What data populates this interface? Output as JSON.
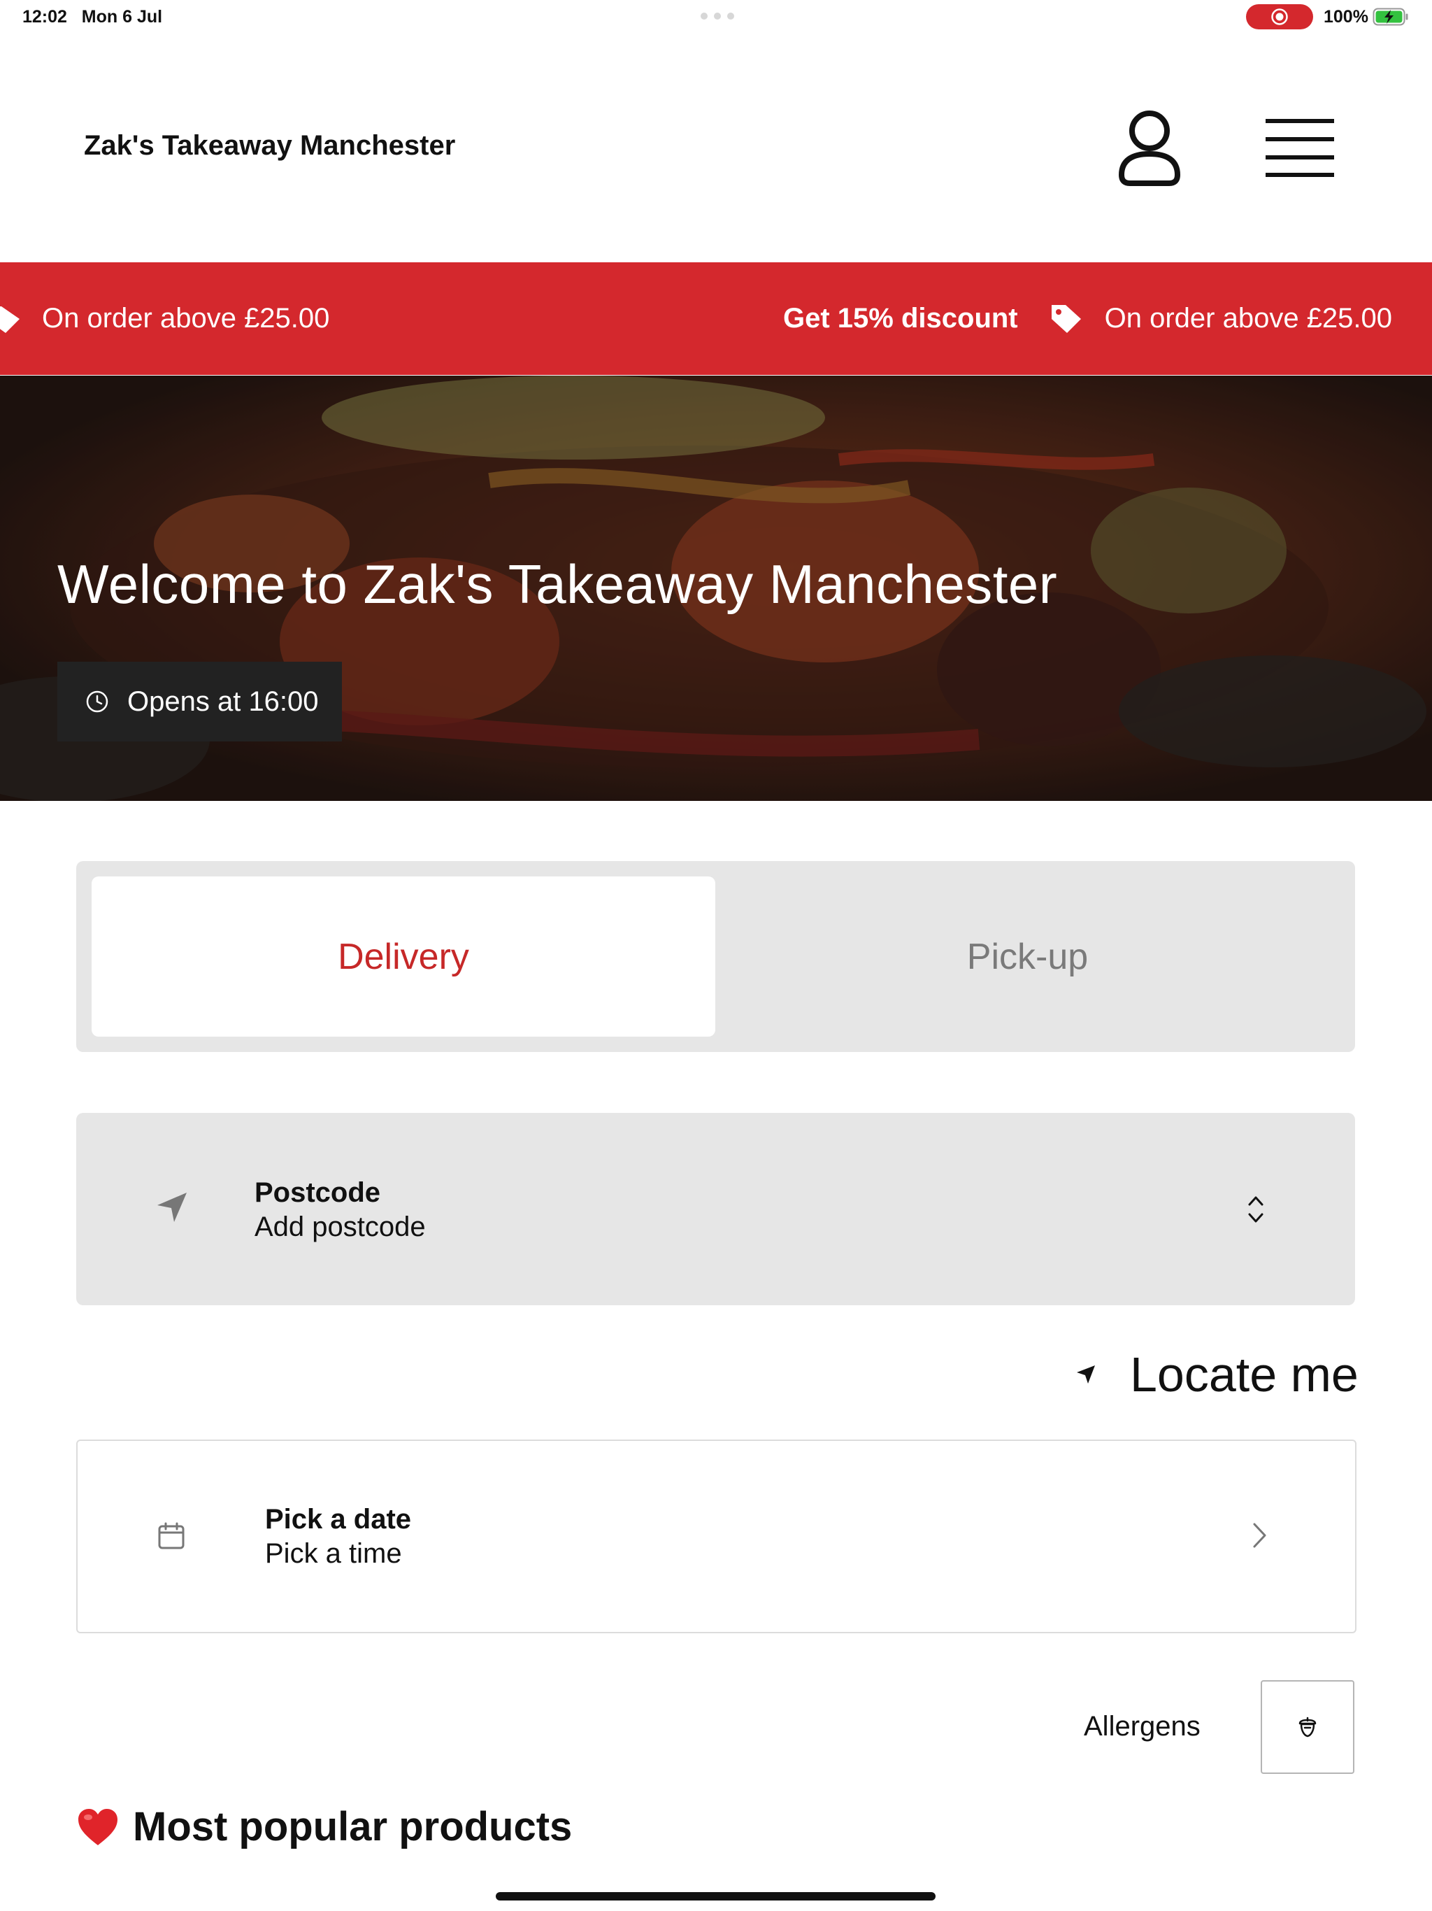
{
  "status_bar": {
    "time": "12:02",
    "date": "Mon 6 Jul",
    "battery": "100%"
  },
  "header": {
    "brand": "Zak's Takeaway Manchester",
    "icons": [
      "user-icon",
      "hamburger-menu-icon"
    ]
  },
  "promo": {
    "condition": "On order above £25.00",
    "headline": "Get 15% discount",
    "background_color": "#d4282d",
    "icon": "tag-icon"
  },
  "hero": {
    "title": "Welcome to Zak's Takeaway Manchester",
    "opening": "Opens at 16:00",
    "icon": "clock-icon"
  },
  "order_mode": {
    "tabs": [
      {
        "label": "Delivery",
        "active": true
      },
      {
        "label": "Pick-up",
        "active": false
      }
    ],
    "accent_color": "#c62828"
  },
  "postcode": {
    "label": "Postcode",
    "placeholder": "Add postcode",
    "icon": "location-arrow-icon"
  },
  "locate": {
    "label": "Locate me",
    "icon": "location-arrow-icon"
  },
  "schedule": {
    "date_label": "Pick a date",
    "time_label": "Pick a time",
    "icon": "calendar-icon"
  },
  "allergens": {
    "label": "Allergens",
    "icon": "acorn-icon"
  },
  "popular": {
    "emoji": "❤️",
    "title": "Most popular products"
  }
}
